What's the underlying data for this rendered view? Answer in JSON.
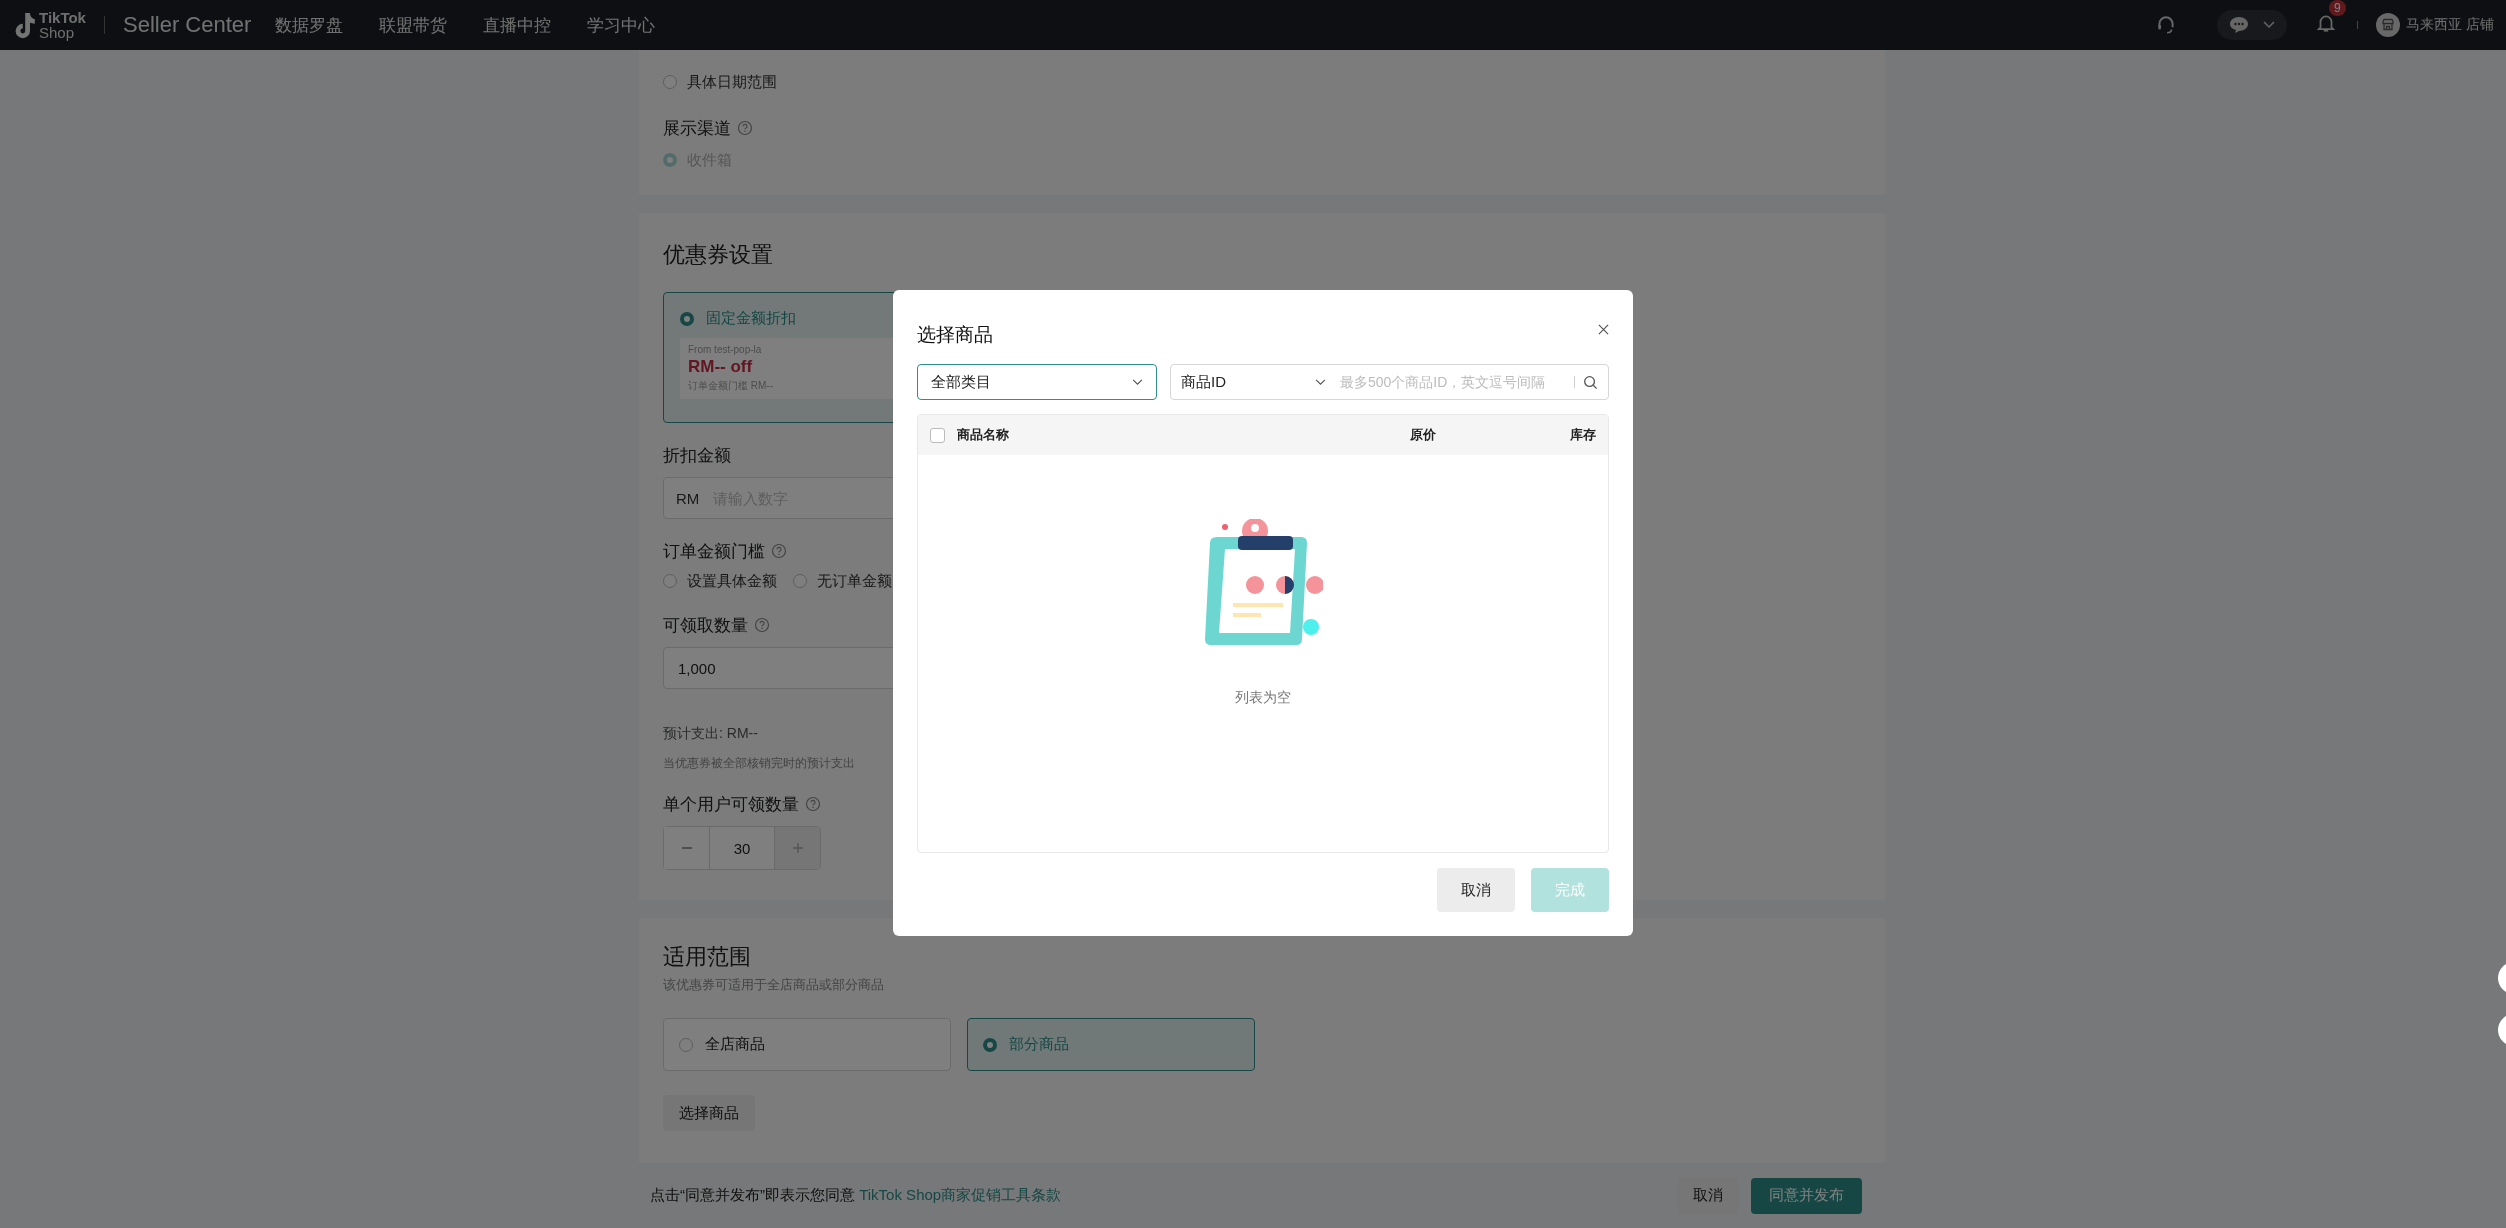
{
  "header": {
    "logo_top": "TikTok",
    "logo_bottom": "Shop",
    "app_name": "Seller Center",
    "nav": [
      "数据罗盘",
      "联盟带货",
      "直播中控",
      "学习中心"
    ],
    "notification_count": "9",
    "store_name": "马来西亚 店铺"
  },
  "validity": {
    "options": [
      {
        "label": "具体日期范围",
        "selected": false
      }
    ]
  },
  "channel": {
    "label": "展示渠道",
    "options": [
      {
        "label": "收件箱",
        "selected": true,
        "disabled": true
      }
    ]
  },
  "coupon_settings": {
    "title": "优惠券设置",
    "coupon_types": [
      {
        "title": "固定金额折扣",
        "selected": true,
        "preview": {
          "from": "From test-pop-la",
          "amount": "RM-- off",
          "threshold": "订单金额门槛 RM--"
        }
      }
    ],
    "discount": {
      "label": "折扣金额",
      "prefix": "RM",
      "placeholder": "请输入数字"
    },
    "threshold": {
      "label": "订单金额门槛",
      "options": [
        {
          "label": "设置具体金额",
          "selected": false
        },
        {
          "label": "无订单金额",
          "selected": false
        }
      ]
    },
    "quantity": {
      "label": "可领取数量",
      "value": "1,000"
    },
    "estimate": {
      "text": "预计支出: RM--",
      "note": "当优惠券被全部核销完时的预计支出"
    },
    "per_user": {
      "label": "单个用户可领数量",
      "value": "30",
      "plus_disabled": true
    }
  },
  "scope": {
    "title": "适用范围",
    "subtitle": "该优惠券可适用于全店商品或部分商品",
    "options": [
      {
        "label": "全店商品",
        "selected": false
      },
      {
        "label": "部分商品",
        "selected": true
      }
    ],
    "button": "选择商品"
  },
  "footer": {
    "notice": "点击“同意并发布”即表示您同意",
    "link": "TikTok Shop商家促销工具条款",
    "cancel": "取消",
    "publish": "同意并发布"
  },
  "modal": {
    "title": "选择商品",
    "category": "全部类目",
    "search_type": "商品ID",
    "search_placeholder": "最多500个商品ID，英文逗号间隔",
    "select_all": false,
    "columns": [
      "商品名称",
      "原价",
      "库存"
    ],
    "empty_text": "列表为空",
    "cancel": "取消",
    "confirm": {
      "label": "完成",
      "disabled": true
    }
  }
}
